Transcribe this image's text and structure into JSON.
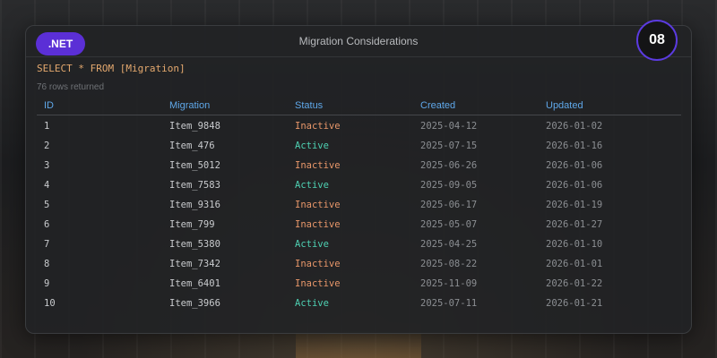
{
  "header": {
    "badge": ".NET",
    "title": "Migration Considerations",
    "number": "08"
  },
  "query": {
    "sql": "SELECT * FROM [Migration]",
    "rows_returned": "76 rows returned"
  },
  "table": {
    "columns": [
      "ID",
      "Migration",
      "Status",
      "Created",
      "Updated"
    ],
    "rows": [
      {
        "id": "1",
        "migration": "Item_9848",
        "status": "Inactive",
        "created": "2025-04-12",
        "updated": "2026-01-02"
      },
      {
        "id": "2",
        "migration": "Item_476",
        "status": "Active",
        "created": "2025-07-15",
        "updated": "2026-01-16"
      },
      {
        "id": "3",
        "migration": "Item_5012",
        "status": "Inactive",
        "created": "2025-06-26",
        "updated": "2026-01-06"
      },
      {
        "id": "4",
        "migration": "Item_7583",
        "status": "Active",
        "created": "2025-09-05",
        "updated": "2026-01-06"
      },
      {
        "id": "5",
        "migration": "Item_9316",
        "status": "Inactive",
        "created": "2025-06-17",
        "updated": "2026-01-19"
      },
      {
        "id": "6",
        "migration": "Item_799",
        "status": "Inactive",
        "created": "2025-05-07",
        "updated": "2026-01-27"
      },
      {
        "id": "7",
        "migration": "Item_5380",
        "status": "Active",
        "created": "2025-04-25",
        "updated": "2026-01-10"
      },
      {
        "id": "8",
        "migration": "Item_7342",
        "status": "Inactive",
        "created": "2025-08-22",
        "updated": "2026-01-01"
      },
      {
        "id": "9",
        "migration": "Item_6401",
        "status": "Inactive",
        "created": "2025-11-09",
        "updated": "2026-01-22"
      },
      {
        "id": "10",
        "migration": "Item_3966",
        "status": "Active",
        "created": "2025-07-11",
        "updated": "2026-01-21"
      }
    ]
  },
  "colors": {
    "badge": "#5b2fd6",
    "header_text": "#5fa8ea",
    "active": "#4ed0b2",
    "inactive": "#e8976a",
    "query": "#e4a86e"
  }
}
